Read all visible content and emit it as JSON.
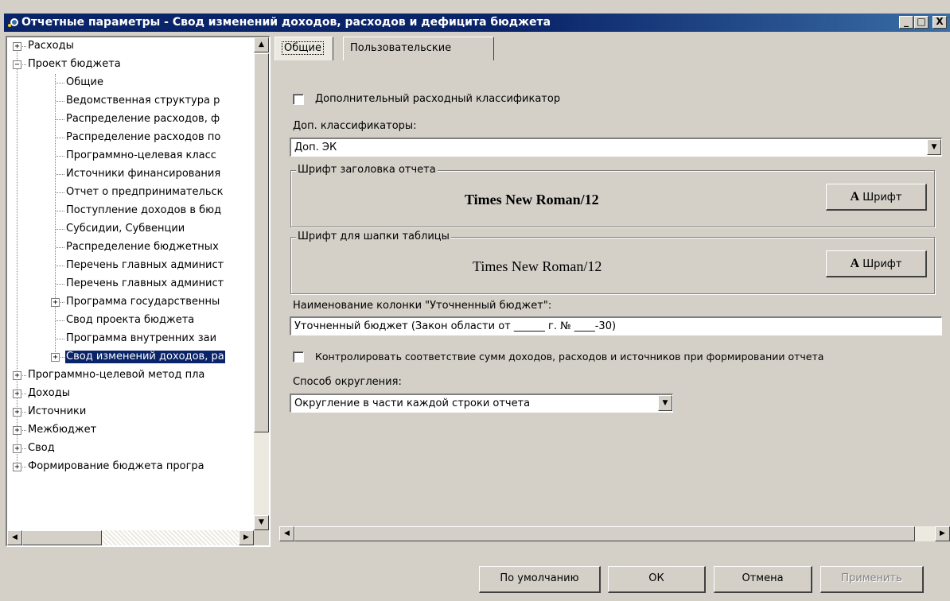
{
  "window": {
    "title": "Отчетные параметры - Свод изменений доходов, расходов и дефицита бюджета",
    "minimize": "_",
    "maximize": "□",
    "close": "X"
  },
  "tree": {
    "items": [
      {
        "label": "Расходы",
        "level": 0,
        "expander": "+"
      },
      {
        "label": "Проект бюджета",
        "level": 0,
        "expander": "−"
      },
      {
        "label": "Общие",
        "level": 1,
        "expander": ""
      },
      {
        "label": "Ведомственная структура р",
        "level": 1,
        "expander": ""
      },
      {
        "label": "Распределение расходов, ф",
        "level": 1,
        "expander": ""
      },
      {
        "label": "Распределение расходов по",
        "level": 1,
        "expander": ""
      },
      {
        "label": "Программно-целевая класс",
        "level": 1,
        "expander": ""
      },
      {
        "label": "Источники финансирования",
        "level": 1,
        "expander": ""
      },
      {
        "label": "Отчет о предпринимательск",
        "level": 1,
        "expander": ""
      },
      {
        "label": "Поступление доходов в бюд",
        "level": 1,
        "expander": ""
      },
      {
        "label": "Субсидии, Субвенции",
        "level": 1,
        "expander": ""
      },
      {
        "label": "Распределение бюджетных",
        "level": 1,
        "expander": ""
      },
      {
        "label": "Перечень главных админист",
        "level": 1,
        "expander": ""
      },
      {
        "label": "Перечень главных админист",
        "level": 1,
        "expander": ""
      },
      {
        "label": "Программа государственны",
        "level": 1,
        "expander": "+"
      },
      {
        "label": "Свод проекта бюджета",
        "level": 1,
        "expander": ""
      },
      {
        "label": "Программа внутренних заи",
        "level": 1,
        "expander": ""
      },
      {
        "label": "Свод изменений доходов, ра",
        "level": 1,
        "expander": "+",
        "selected": true
      },
      {
        "label": "Программно-целевой метод пла",
        "level": 0,
        "expander": "+"
      },
      {
        "label": "Доходы",
        "level": 0,
        "expander": "+"
      },
      {
        "label": "Источники",
        "level": 0,
        "expander": "+"
      },
      {
        "label": "Межбюджет",
        "level": 0,
        "expander": "+"
      },
      {
        "label": "Свод",
        "level": 0,
        "expander": "+"
      },
      {
        "label": "Формирование бюджета програ",
        "level": 0,
        "expander": "+"
      }
    ]
  },
  "tabs": [
    {
      "label": "Общие",
      "active": true
    },
    {
      "label": "Пользовательские",
      "active": false
    }
  ],
  "form": {
    "extra_classifier_label": "Дополнительный расходный классификатор",
    "extra_classifier_checked": false,
    "classifiers_label": "Доп. классификаторы:",
    "classifiers_value": "Доп. ЭК",
    "header_font_group": "Шрифт заголовка отчета",
    "header_font_value": "Times New Roman/12",
    "table_font_group": "Шрифт для шапки таблицы",
    "table_font_value": "Times New Roman/12",
    "font_button": "Шрифт",
    "font_button_icon": "A",
    "column_name_label": "Наименование колонки \"Уточненный бюджет\":",
    "column_name_value": "Уточненный бюджет (Закон области от ______ г. № ____-30)",
    "control_sums_label": "Контролировать соответствие сумм доходов, расходов и источников при формировании отчета",
    "control_sums_checked": false,
    "rounding_label": "Способ округления:",
    "rounding_value": "Округление в части каждой строки отчета"
  },
  "buttons": {
    "default": "По умолчанию",
    "ok": "ОК",
    "cancel": "Отмена",
    "apply": "Применить"
  },
  "colors": {
    "title_bar": "#0a246a",
    "selection": "#0a246a",
    "face": "#d4d0c8"
  }
}
